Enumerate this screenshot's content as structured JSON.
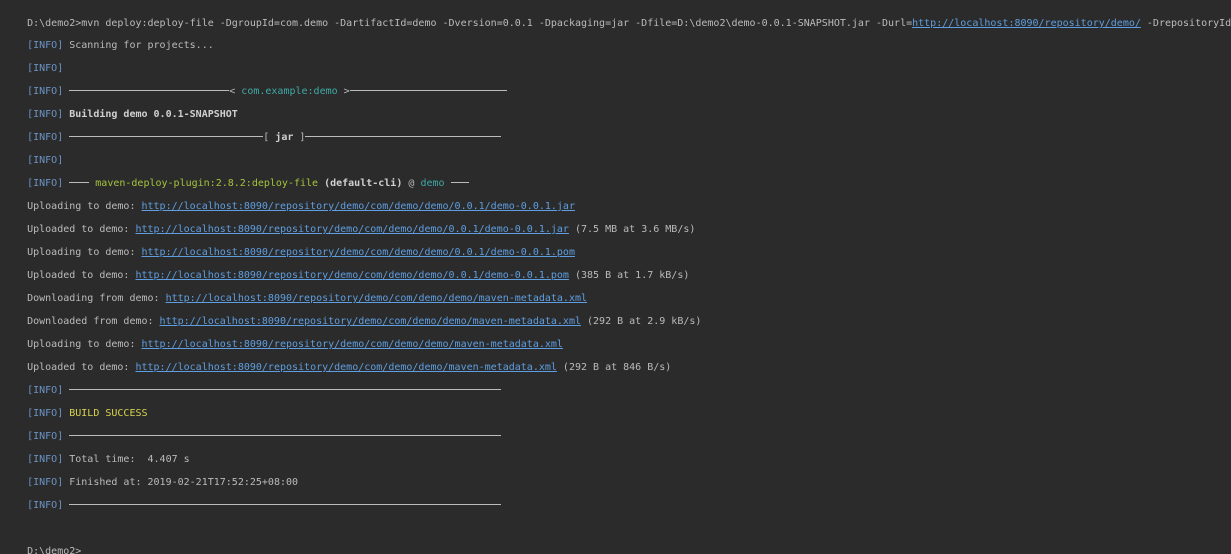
{
  "command": {
    "prefix": "D:\\demo2>mvn deploy:deploy-file -DgroupId=com.demo -DartifactId=demo -Dversion=0.0.1 -Dpackaging=jar -Dfile=D:\\demo2\\demo-0.0.1-SNAPSHOT.jar -Durl=",
    "url": "http://localhost:8090/repository/demo/",
    "suffix": " -DrepositoryId=demo"
  },
  "info_tag": "[INFO]",
  "scanning": "Scanning for projects...",
  "project_id": "com.example:demo",
  "building": "Building demo 0.0.1-SNAPSHOT",
  "packaging": "jar",
  "plugin": {
    "name": "maven-deploy-plugin:2.8.2:deploy-file",
    "execution": "(default-cli)",
    "at": "@",
    "project": "demo"
  },
  "transfers": [
    {
      "label": "Uploading to demo: ",
      "url": "http://localhost:8090/repository/demo/com/demo/demo/0.0.1/demo-0.0.1.jar",
      "stats": ""
    },
    {
      "label": "Uploaded to demo: ",
      "url": "http://localhost:8090/repository/demo/com/demo/demo/0.0.1/demo-0.0.1.jar",
      "stats": " (7.5 MB at 3.6 MB/s)"
    },
    {
      "label": "Uploading to demo: ",
      "url": "http://localhost:8090/repository/demo/com/demo/demo/0.0.1/demo-0.0.1.pom",
      "stats": ""
    },
    {
      "label": "Uploaded to demo: ",
      "url": "http://localhost:8090/repository/demo/com/demo/demo/0.0.1/demo-0.0.1.pom",
      "stats": " (385 B at 1.7 kB/s)"
    },
    {
      "label": "Downloading from demo: ",
      "url": "http://localhost:8090/repository/demo/com/demo/demo/maven-metadata.xml",
      "stats": ""
    },
    {
      "label": "Downloaded from demo: ",
      "url": "http://localhost:8090/repository/demo/com/demo/demo/maven-metadata.xml",
      "stats": " (292 B at 2.9 kB/s)"
    },
    {
      "label": "Uploading to demo: ",
      "url": "http://localhost:8090/repository/demo/com/demo/demo/maven-metadata.xml",
      "stats": ""
    },
    {
      "label": "Uploaded to demo: ",
      "url": "http://localhost:8090/repository/demo/com/demo/demo/maven-metadata.xml",
      "stats": " (292 B at 846 B/s)"
    }
  ],
  "result": "BUILD SUCCESS",
  "total_time": "Total time:  4.407 s",
  "finished_at": "Finished at: 2019-02-21T17:52:25+08:00",
  "prompt": "D:\\demo2>",
  "colors": {
    "background": "#2b2b2b",
    "text": "#bbbbbb",
    "info": "#6c93c5",
    "link": "#5f9ee0",
    "cyan": "#3fa9a5",
    "green": "#a6c33b",
    "yellow": "#d8d44f"
  }
}
